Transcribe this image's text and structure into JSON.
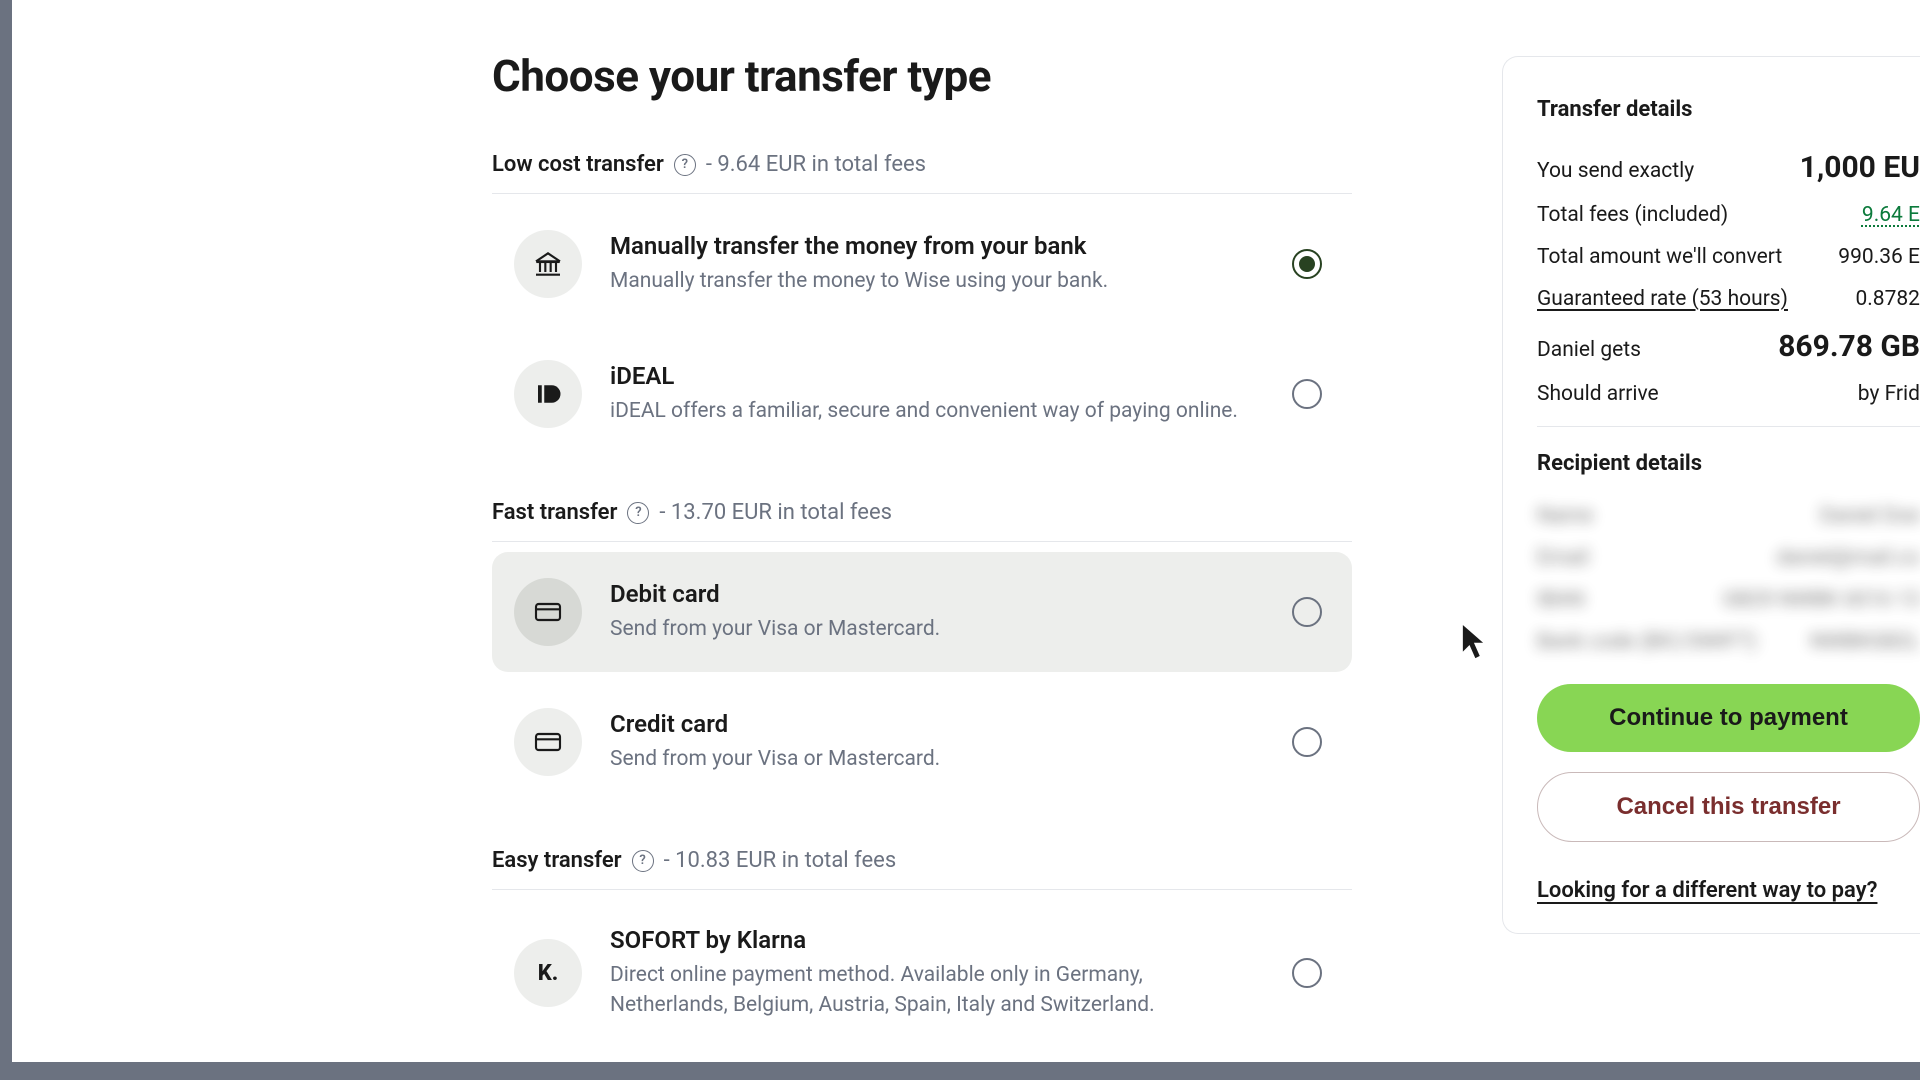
{
  "page": {
    "title": "Choose your transfer type"
  },
  "sections": {
    "low": {
      "title": "Low cost transfer",
      "fees": "- 9.64 EUR in total fees"
    },
    "fast": {
      "title": "Fast transfer",
      "fees": "- 13.70 EUR in total fees"
    },
    "easy": {
      "title": "Easy transfer",
      "fees": "- 10.83 EUR in total fees"
    }
  },
  "options": {
    "bank": {
      "title": "Manually transfer the money from your bank",
      "desc": "Manually transfer the money to Wise using your bank."
    },
    "ideal": {
      "title": "iDEAL",
      "desc": "iDEAL offers a familiar, secure and convenient way of paying online."
    },
    "debit": {
      "title": "Debit card",
      "desc": "Send from your Visa or Mastercard."
    },
    "credit": {
      "title": "Credit card",
      "desc": "Send from your Visa or Mastercard."
    },
    "sofort": {
      "title": "SOFORT by Klarna",
      "desc": "Direct online payment method. Available only in Germany, Netherlands, Belgium, Austria, Spain, Italy and Switzerland."
    }
  },
  "sidebar": {
    "transfer_heading": "Transfer details",
    "rows": {
      "send_label": "You send exactly",
      "send_value": "1,000 EU",
      "fees_label": "Total fees (included)",
      "fees_value": "9.64 E",
      "convert_label": "Total amount we'll convert",
      "convert_value": "990.36 E",
      "rate_label": "Guaranteed rate (53 hours)",
      "rate_value": "0.8782",
      "gets_label": "Daniel gets",
      "gets_value": "869.78 GB",
      "arrive_label": "Should arrive",
      "arrive_value": "by Frid"
    },
    "recipient_heading": "Recipient details",
    "blurred": {
      "a_label": "Name",
      "a_value": "Daniel Doe",
      "b_label": "Email",
      "b_value": "daniel@mail.co",
      "c_label": "IBAN",
      "c_value": "GB29 NWBK 6016 13",
      "d_label": "Bank code (BIC/SWIFT)",
      "d_value": "NWBKGB2L"
    },
    "continue": "Continue to payment",
    "cancel": "Cancel this transfer",
    "alt_link": "Looking for a different way to pay?"
  }
}
